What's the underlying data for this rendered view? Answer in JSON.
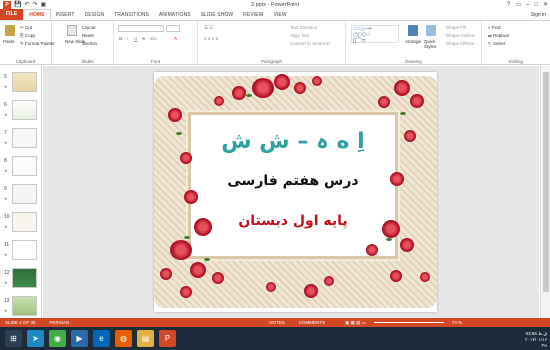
{
  "window": {
    "title": "2.pptx - PowerPoint",
    "sign_in": "Sign in"
  },
  "qat": {
    "save": "💾",
    "undo": "↶",
    "redo": "↷",
    "present": "▣"
  },
  "tabs": [
    "FILE",
    "HOME",
    "INSERT",
    "DESIGN",
    "TRANSITIONS",
    "ANIMATIONS",
    "SLIDE SHOW",
    "REVIEW",
    "VIEW"
  ],
  "active_tab": "HOME",
  "ribbon": {
    "clipboard": {
      "paste": "Paste",
      "cut": "Cut",
      "copy": "Copy",
      "format_painter": "Format Painter",
      "label": "Clipboard"
    },
    "slides": {
      "new_slide": "New Slide",
      "layout": "Layout",
      "reset": "Reset",
      "section": "Section",
      "label": "Slides"
    },
    "font": {
      "label": "Font",
      "bold": "B",
      "italic": "I",
      "underline": "U",
      "strike": "S",
      "shadow": "abc",
      "aa": "A"
    },
    "paragraph": {
      "label": "Paragraph",
      "text_direction": "Text Direction",
      "align_text": "Align Text",
      "smartart": "Convert to SmartArt"
    },
    "drawing": {
      "label": "Drawing",
      "arrange": "Arrange",
      "quick_styles": "Quick Styles",
      "shape_fill": "Shape Fill",
      "shape_outline": "Shape Outline",
      "shape_effects": "Shape Effects"
    },
    "editing": {
      "label": "Editing",
      "find": "Find",
      "replace": "Replace",
      "select": "Select"
    }
  },
  "thumbnails": [
    {
      "num": "5",
      "star": "★"
    },
    {
      "num": "6",
      "star": "★"
    },
    {
      "num": "7",
      "star": "★"
    },
    {
      "num": "8",
      "star": "★"
    },
    {
      "num": "9",
      "star": "★"
    },
    {
      "num": "10",
      "star": "★"
    },
    {
      "num": "11",
      "star": "★"
    },
    {
      "num": "12",
      "star": "★"
    },
    {
      "num": "13",
      "star": "★"
    }
  ],
  "slide": {
    "line1": "اِ ه ہ – ش ش",
    "line2": "درس هفتم فارسی",
    "line3": "پایه اول دبستان",
    "colors": {
      "line1": "#2fa3a0",
      "line2": "#111111",
      "line3": "#c0101a"
    }
  },
  "status": {
    "slide": "SLIDE 2 OF 36",
    "language": "PERSIAN",
    "notes": "NOTES",
    "comments": "COMMENTS",
    "zoom": "74 %"
  },
  "tray": {
    "lang": "FA",
    "time": "03:56 ق.ظ",
    "date": "۲۰۱۷/۰۱/۱۶"
  },
  "accent": "#d24726"
}
